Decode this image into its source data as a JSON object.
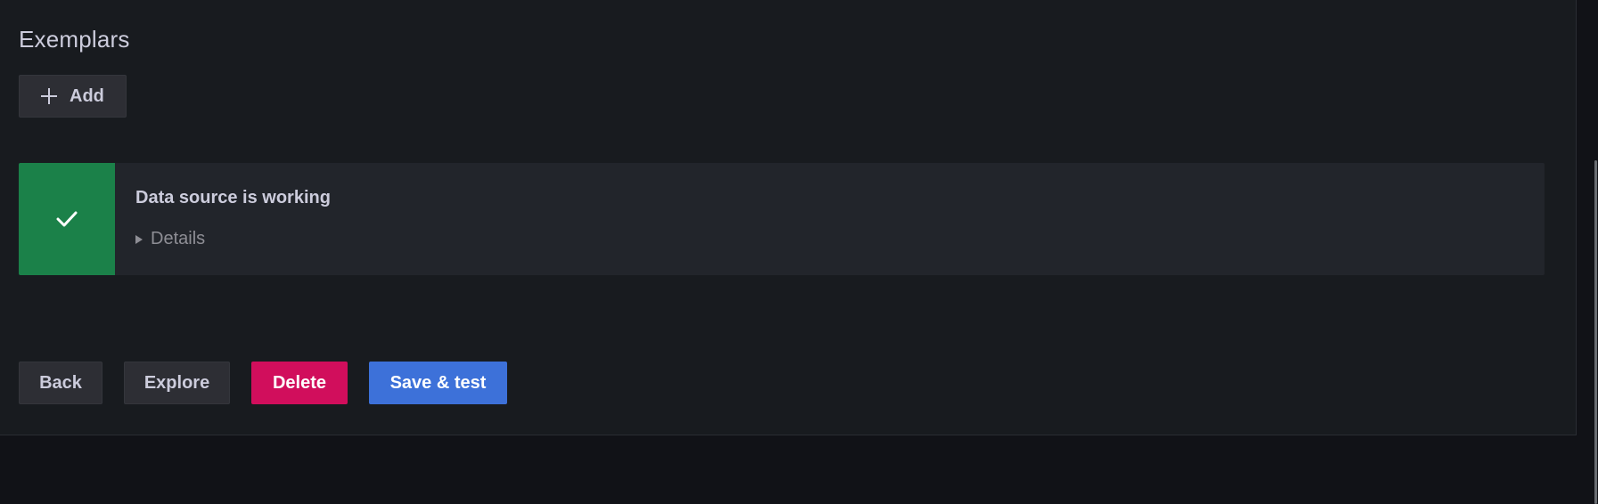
{
  "exemplars": {
    "title": "Exemplars",
    "add_label": "Add",
    "add_icon": "plus-icon"
  },
  "alert": {
    "status": "success",
    "icon": "check-icon",
    "title": "Data source is working",
    "details_label": "Details",
    "colors": {
      "success": "#1b8149",
      "background": "#22252b"
    }
  },
  "actions": {
    "back_label": "Back",
    "explore_label": "Explore",
    "delete_label": "Delete",
    "save_label": "Save & test",
    "colors": {
      "danger": "#d10e5c",
      "primary": "#3d71d9",
      "secondary": "#2d2e34"
    }
  }
}
